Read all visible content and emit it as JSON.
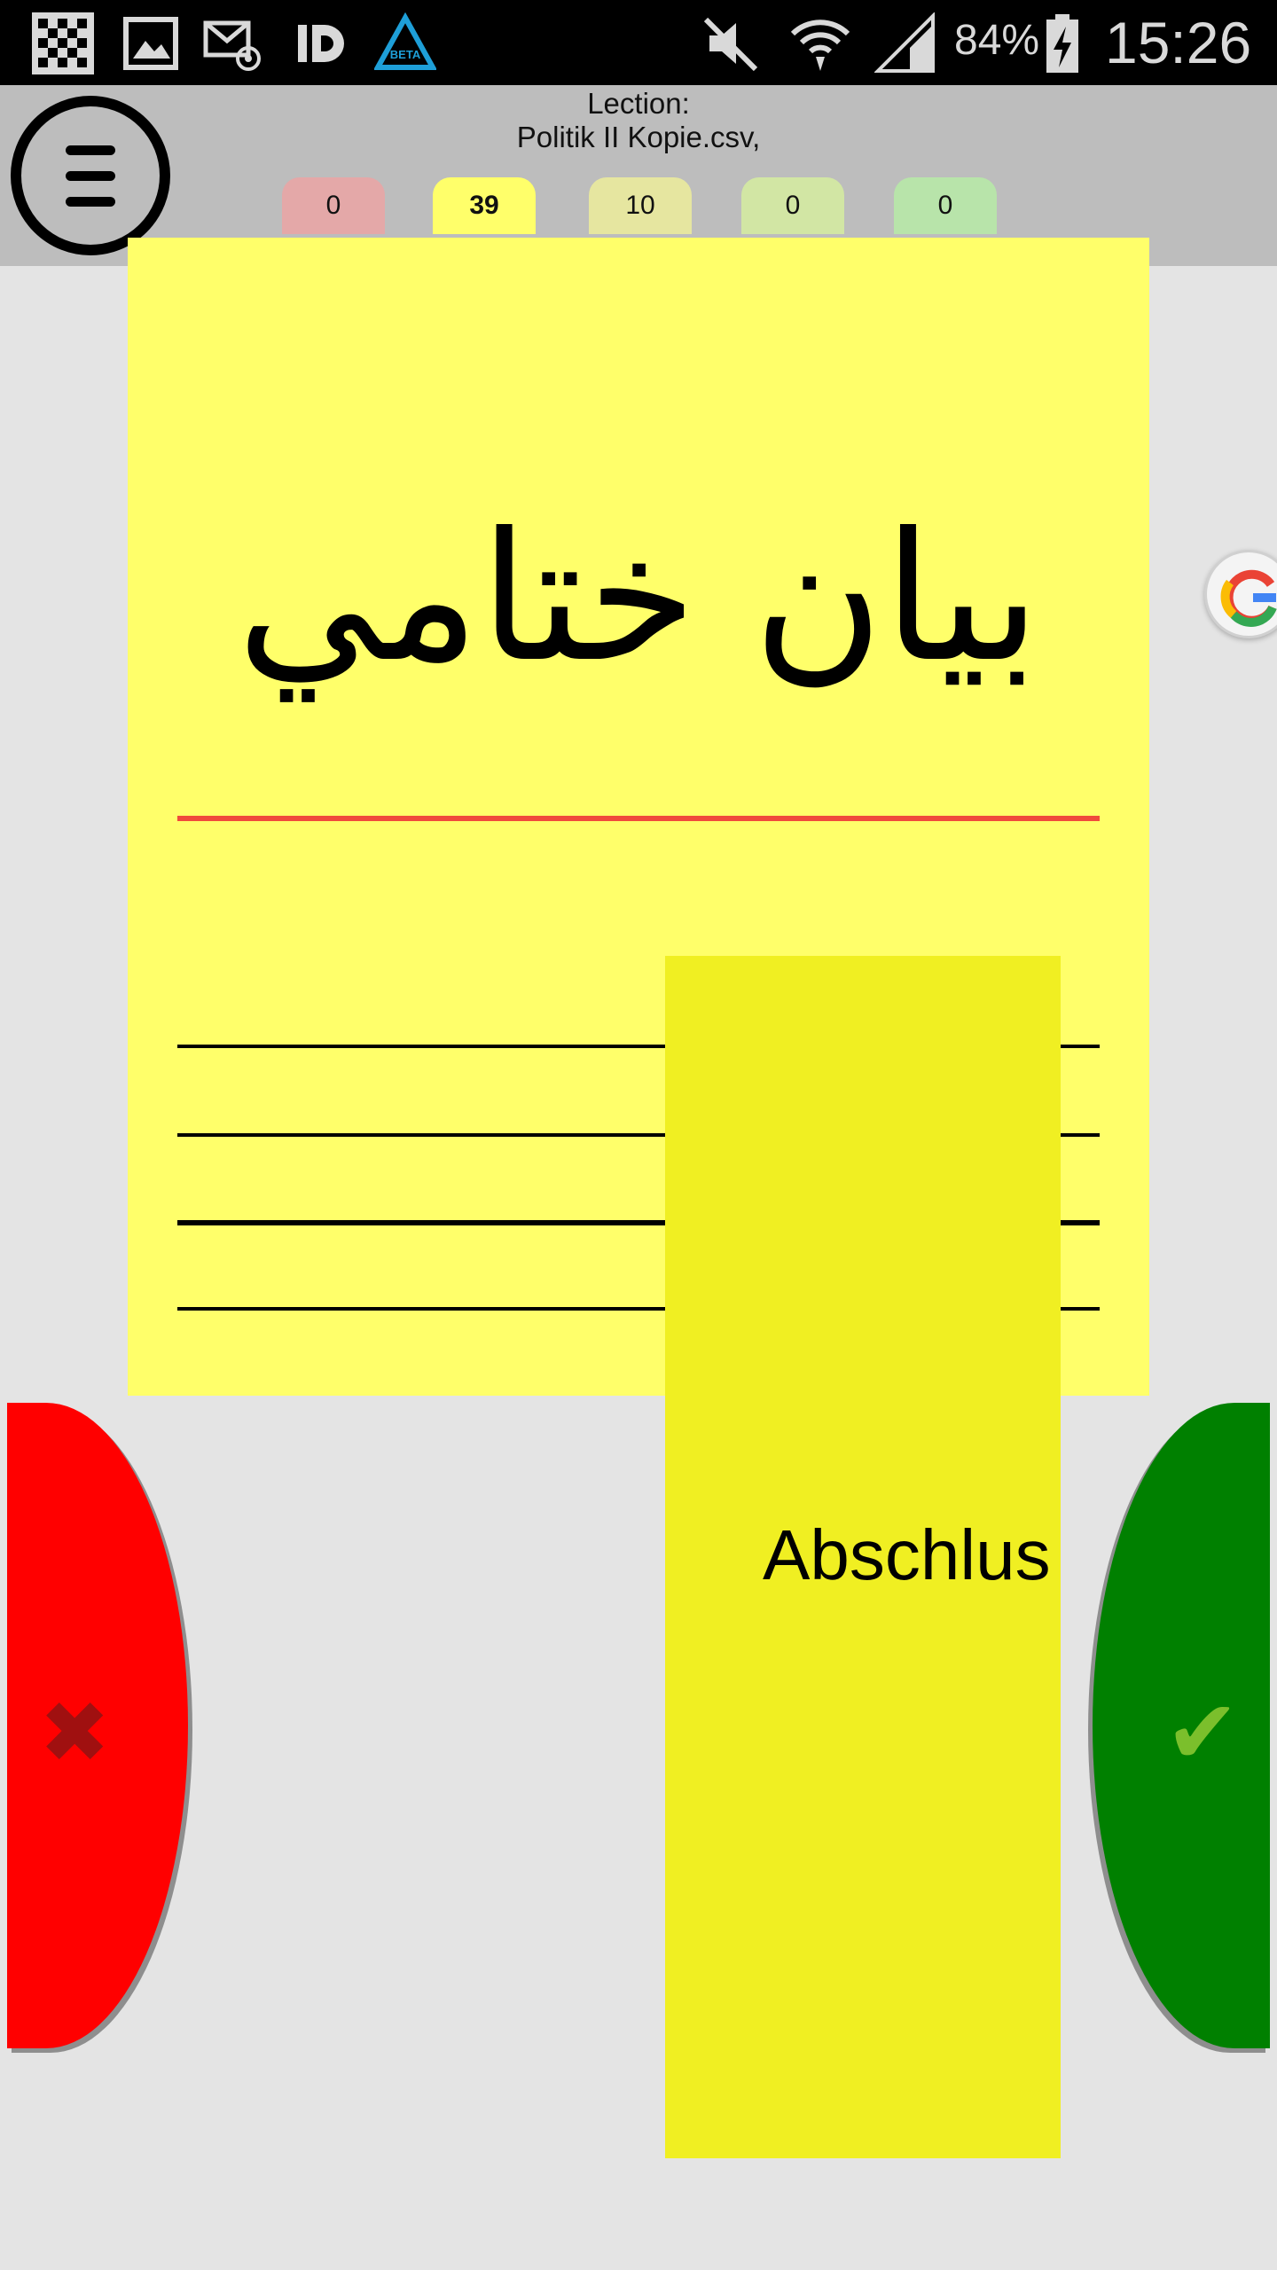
{
  "status_bar": {
    "battery": "84%",
    "time": "15:26",
    "icons": [
      "checkerboard-icon",
      "gallery-icon",
      "mail-at-icon",
      "id-app-icon",
      "beta-app-icon",
      "mute-icon",
      "wifi-icon",
      "signal-icon",
      "battery-charging-icon"
    ]
  },
  "header": {
    "lection_label": "Lection:",
    "lection_file": "Politik II Kopie.csv,",
    "menu_icon": "hamburger-icon",
    "box_tabs": [
      {
        "count": "0",
        "color": "#e4a8a8"
      },
      {
        "count": "39",
        "color": "#ffff6a",
        "active": true
      },
      {
        "count": "10",
        "color": "#e6e6a0"
      },
      {
        "count": "0",
        "color": "#d2e6a4"
      },
      {
        "count": "0",
        "color": "#b8e4aa"
      }
    ]
  },
  "card": {
    "word": "بيان ختامي",
    "background": "#ffff6a",
    "divider_color": "#f04a3c"
  },
  "answer_panel": {
    "text": "Abschlus",
    "background": "#f0ef22"
  },
  "buttons": {
    "wrong": {
      "icon": "cross-icon",
      "color": "#ff0000"
    },
    "right": {
      "icon": "check-icon",
      "color": "#008000"
    }
  },
  "floating": {
    "icon": "google-icon"
  }
}
